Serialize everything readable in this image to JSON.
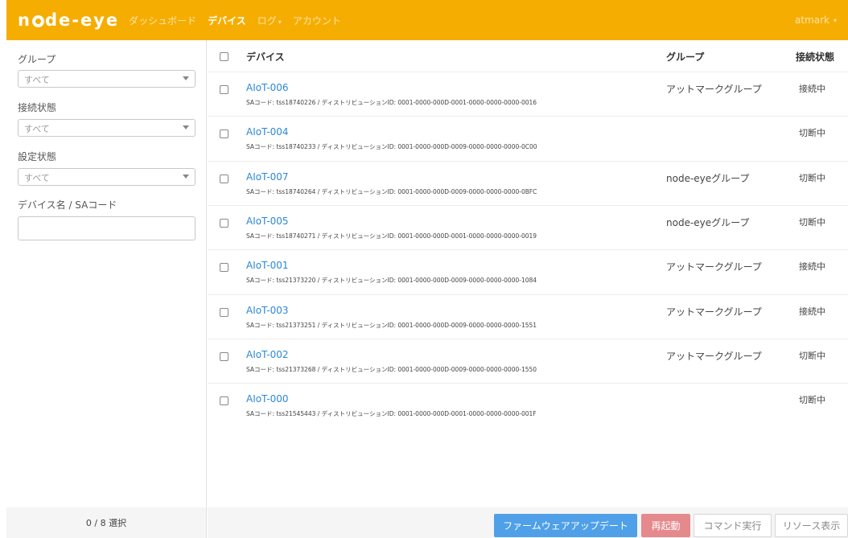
{
  "navbar": {
    "logo": {
      "pre": "n",
      "post": "de-eye"
    },
    "items": [
      {
        "label": "ダッシュボード",
        "active": false
      },
      {
        "label": "デバイス",
        "active": true
      },
      {
        "label": "ログ",
        "active": false,
        "dropdown": true
      },
      {
        "label": "アカウント",
        "active": false
      }
    ],
    "user": "atmark",
    "colors": {
      "bar": "#f6ad02"
    }
  },
  "sidebar": {
    "group_label": "グループ",
    "group_value": "すべて",
    "connection_label": "接続状態",
    "connection_value": "すべて",
    "config_label": "設定状態",
    "config_value": "すべて",
    "search_label": "デバイス名 / SAコード",
    "search_value": "",
    "selection_count": "0 / 8 選択"
  },
  "table": {
    "headers": {
      "device": "デバイス",
      "group": "グループ",
      "status": "接続状態"
    },
    "rows": [
      {
        "name": "AIoT-006",
        "sub": "SAコード: tss18740226 / ディストリビューションID: 0001-0000-000D-0001-0000-0000-0000-0016",
        "group": "アットマークグループ",
        "status": "接続中"
      },
      {
        "name": "AIoT-004",
        "sub": "SAコード: tss18740233 / ディストリビューションID: 0001-0000-000D-0009-0000-0000-0000-0C00",
        "group": "",
        "status": "切断中"
      },
      {
        "name": "AIoT-007",
        "sub": "SAコード: tss18740264 / ディストリビューションID: 0001-0000-000D-0009-0000-0000-0000-0BFC",
        "group": "node-eyeグループ",
        "status": "切断中"
      },
      {
        "name": "AIoT-005",
        "sub": "SAコード: tss18740271 / ディストリビューションID: 0001-0000-000D-0001-0000-0000-0000-0019",
        "group": "node-eyeグループ",
        "status": "切断中"
      },
      {
        "name": "AIoT-001",
        "sub": "SAコード: tss21373220 / ディストリビューションID: 0001-0000-000D-0009-0000-0000-0000-1084",
        "group": "アットマークグループ",
        "status": "接続中"
      },
      {
        "name": "AIoT-003",
        "sub": "SAコード: tss21373251 / ディストリビューションID: 0001-0000-000D-0009-0000-0000-0000-1551",
        "group": "アットマークグループ",
        "status": "接続中"
      },
      {
        "name": "AIoT-002",
        "sub": "SAコード: tss21373268 / ディストリビューションID: 0001-0000-000D-0009-0000-0000-0000-1550",
        "group": "アットマークグループ",
        "status": "切断中"
      },
      {
        "name": "AIoT-000",
        "sub": "SAコード: tss21545443 / ディストリビューションID: 0001-0000-000D-0001-0000-0000-0000-001F",
        "group": "",
        "status": "切断中"
      }
    ]
  },
  "actions": {
    "firmware_update": "ファームウェアアップデート",
    "reboot": "再起動",
    "run_command": "コマンド実行",
    "show_resources": "リソース表示",
    "colors": {
      "primary": "#4fa0e8",
      "danger": "#e5898c"
    }
  }
}
